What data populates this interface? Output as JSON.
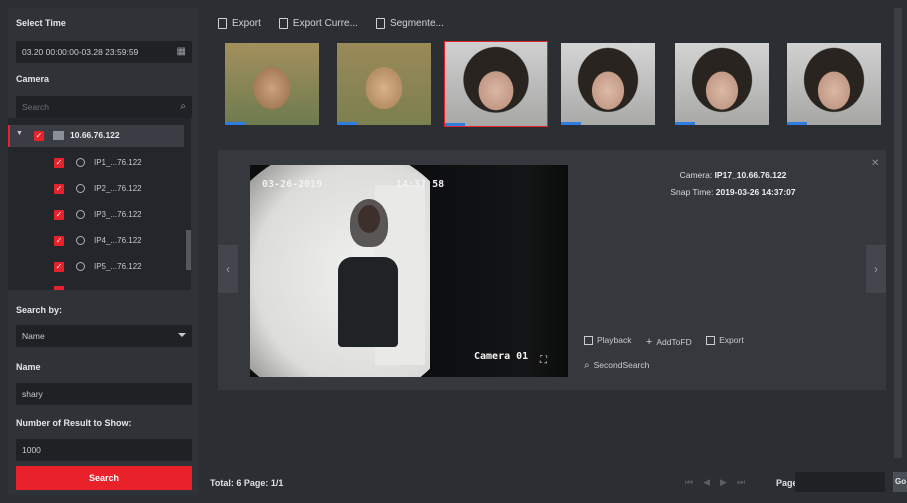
{
  "left": {
    "select_time_label": "Select Time",
    "time_range": "03.20 00:00:00-03.28 23:59:59",
    "camera_label": "Camera",
    "search_placeholder": "Search",
    "tree_root": "10.66.76.122",
    "cameras": [
      "IP1_...76.122",
      "IP2_...76.122",
      "IP3_...76.122",
      "IP4_...76.122",
      "IP5_...76.122"
    ],
    "search_by_label": "Search by:",
    "search_by_value": "Name",
    "name_label": "Name",
    "name_value": "shary",
    "result_count_label": "Number of Result to Show:",
    "result_count_value": "1000",
    "search_button": "Search"
  },
  "toolbar": {
    "export": "Export",
    "export_current": "Export Curre...",
    "segmented": "Segmente..."
  },
  "thumbnails": {
    "count": 6,
    "selected_index": 2
  },
  "detail": {
    "osd_timestamp": "03-26-2019",
    "osd_time": "14:37 58",
    "osd_camera": "Camera 01",
    "camera_label": "Camera:",
    "camera_value": "IP17_10.66.76.122",
    "snap_label": "Snap Time:",
    "snap_value": "2019-03-26 14:37:07",
    "actions": {
      "playback": "Playback",
      "add_to_fd": "AddToFD",
      "export": "Export",
      "second_search": "SecondSearch"
    }
  },
  "footer": {
    "total": "Total: 6  Page: 1/1",
    "page_label": "Page",
    "go": "Go"
  },
  "colors": {
    "accent_red": "#e8212a",
    "progress_blue": "#2f7de1"
  }
}
